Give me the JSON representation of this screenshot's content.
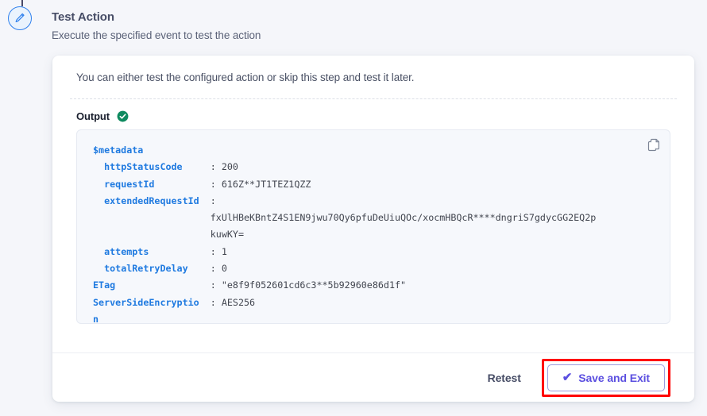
{
  "step": {
    "icon": "pencil-icon",
    "title": "Test Action",
    "subtitle": "Execute the specified event to test the action"
  },
  "card": {
    "intro": "You can either test the configured action or skip this step and test it later.",
    "output": {
      "label": "Output",
      "status_icon": "check-circle-icon",
      "copy_icon": "copy-icon",
      "lines": [
        {
          "key": "$metadata",
          "indent": 0,
          "sep": "",
          "value": ""
        },
        {
          "key": "httpStatusCode",
          "indent": 1,
          "sep": ":",
          "value": "200"
        },
        {
          "key": "requestId",
          "indent": 1,
          "sep": ":",
          "value": "616Z**JT1TEZ1QZZ"
        },
        {
          "key": "extendedRequestId",
          "indent": 1,
          "sep": ":",
          "value": ""
        },
        {
          "key": "",
          "indent": 0,
          "sep": "",
          "value": "fxUlHBeKBntZ4S1EN9jwu70Qy6pfuDeUiuQOc/xocmHBQcR****dngriS7gdycGG2EQ2p"
        },
        {
          "key": "",
          "indent": 0,
          "sep": "",
          "value": "kuwKY="
        },
        {
          "key": "attempts",
          "indent": 1,
          "sep": ":",
          "value": "1"
        },
        {
          "key": "totalRetryDelay",
          "indent": 1,
          "sep": ":",
          "value": "0"
        },
        {
          "key": "ETag",
          "indent": 0,
          "sep": ":",
          "value": "\"e8f9f052601cd6c3**5b92960e86d1f\""
        },
        {
          "key": "ServerSideEncryptio",
          "indent": 0,
          "sep": ":",
          "value": "AES256"
        },
        {
          "key": "n",
          "indent": 0,
          "sep": "",
          "value": ""
        }
      ],
      "raw": "$metadata\n  httpStatusCode     : 200\n  requestId          : 616Z**JT1TEZ1QZZ\n  extendedRequestId  :\n                     fxUlHBeKBntZ4S1EN9jwu70Qy6pfuDeUiuQOc/xocmHBQcR****dngriS7gdycGG2EQ2p\n                     kuwKY=\n  attempts           : 1\n  totalRetryDelay    : 0\nETag                 : \"e8f9f052601cd6c3**5b92960e86d1f\"\nServerSideEncryptio  : AES256\nn"
    },
    "footer": {
      "retest_label": "Retest",
      "save_label": "Save and Exit",
      "save_check_glyph": "✔"
    }
  },
  "colors": {
    "page_bg": "#f5f6fa",
    "card_bg": "#ffffff",
    "code_bg": "#f6f8fc",
    "key_blue": "#1f7ae0",
    "accent_purple": "#5b4fe0",
    "success_green": "#0e8a5f",
    "highlight_red": "#ff0000",
    "step_blue": "#2f80ed"
  }
}
